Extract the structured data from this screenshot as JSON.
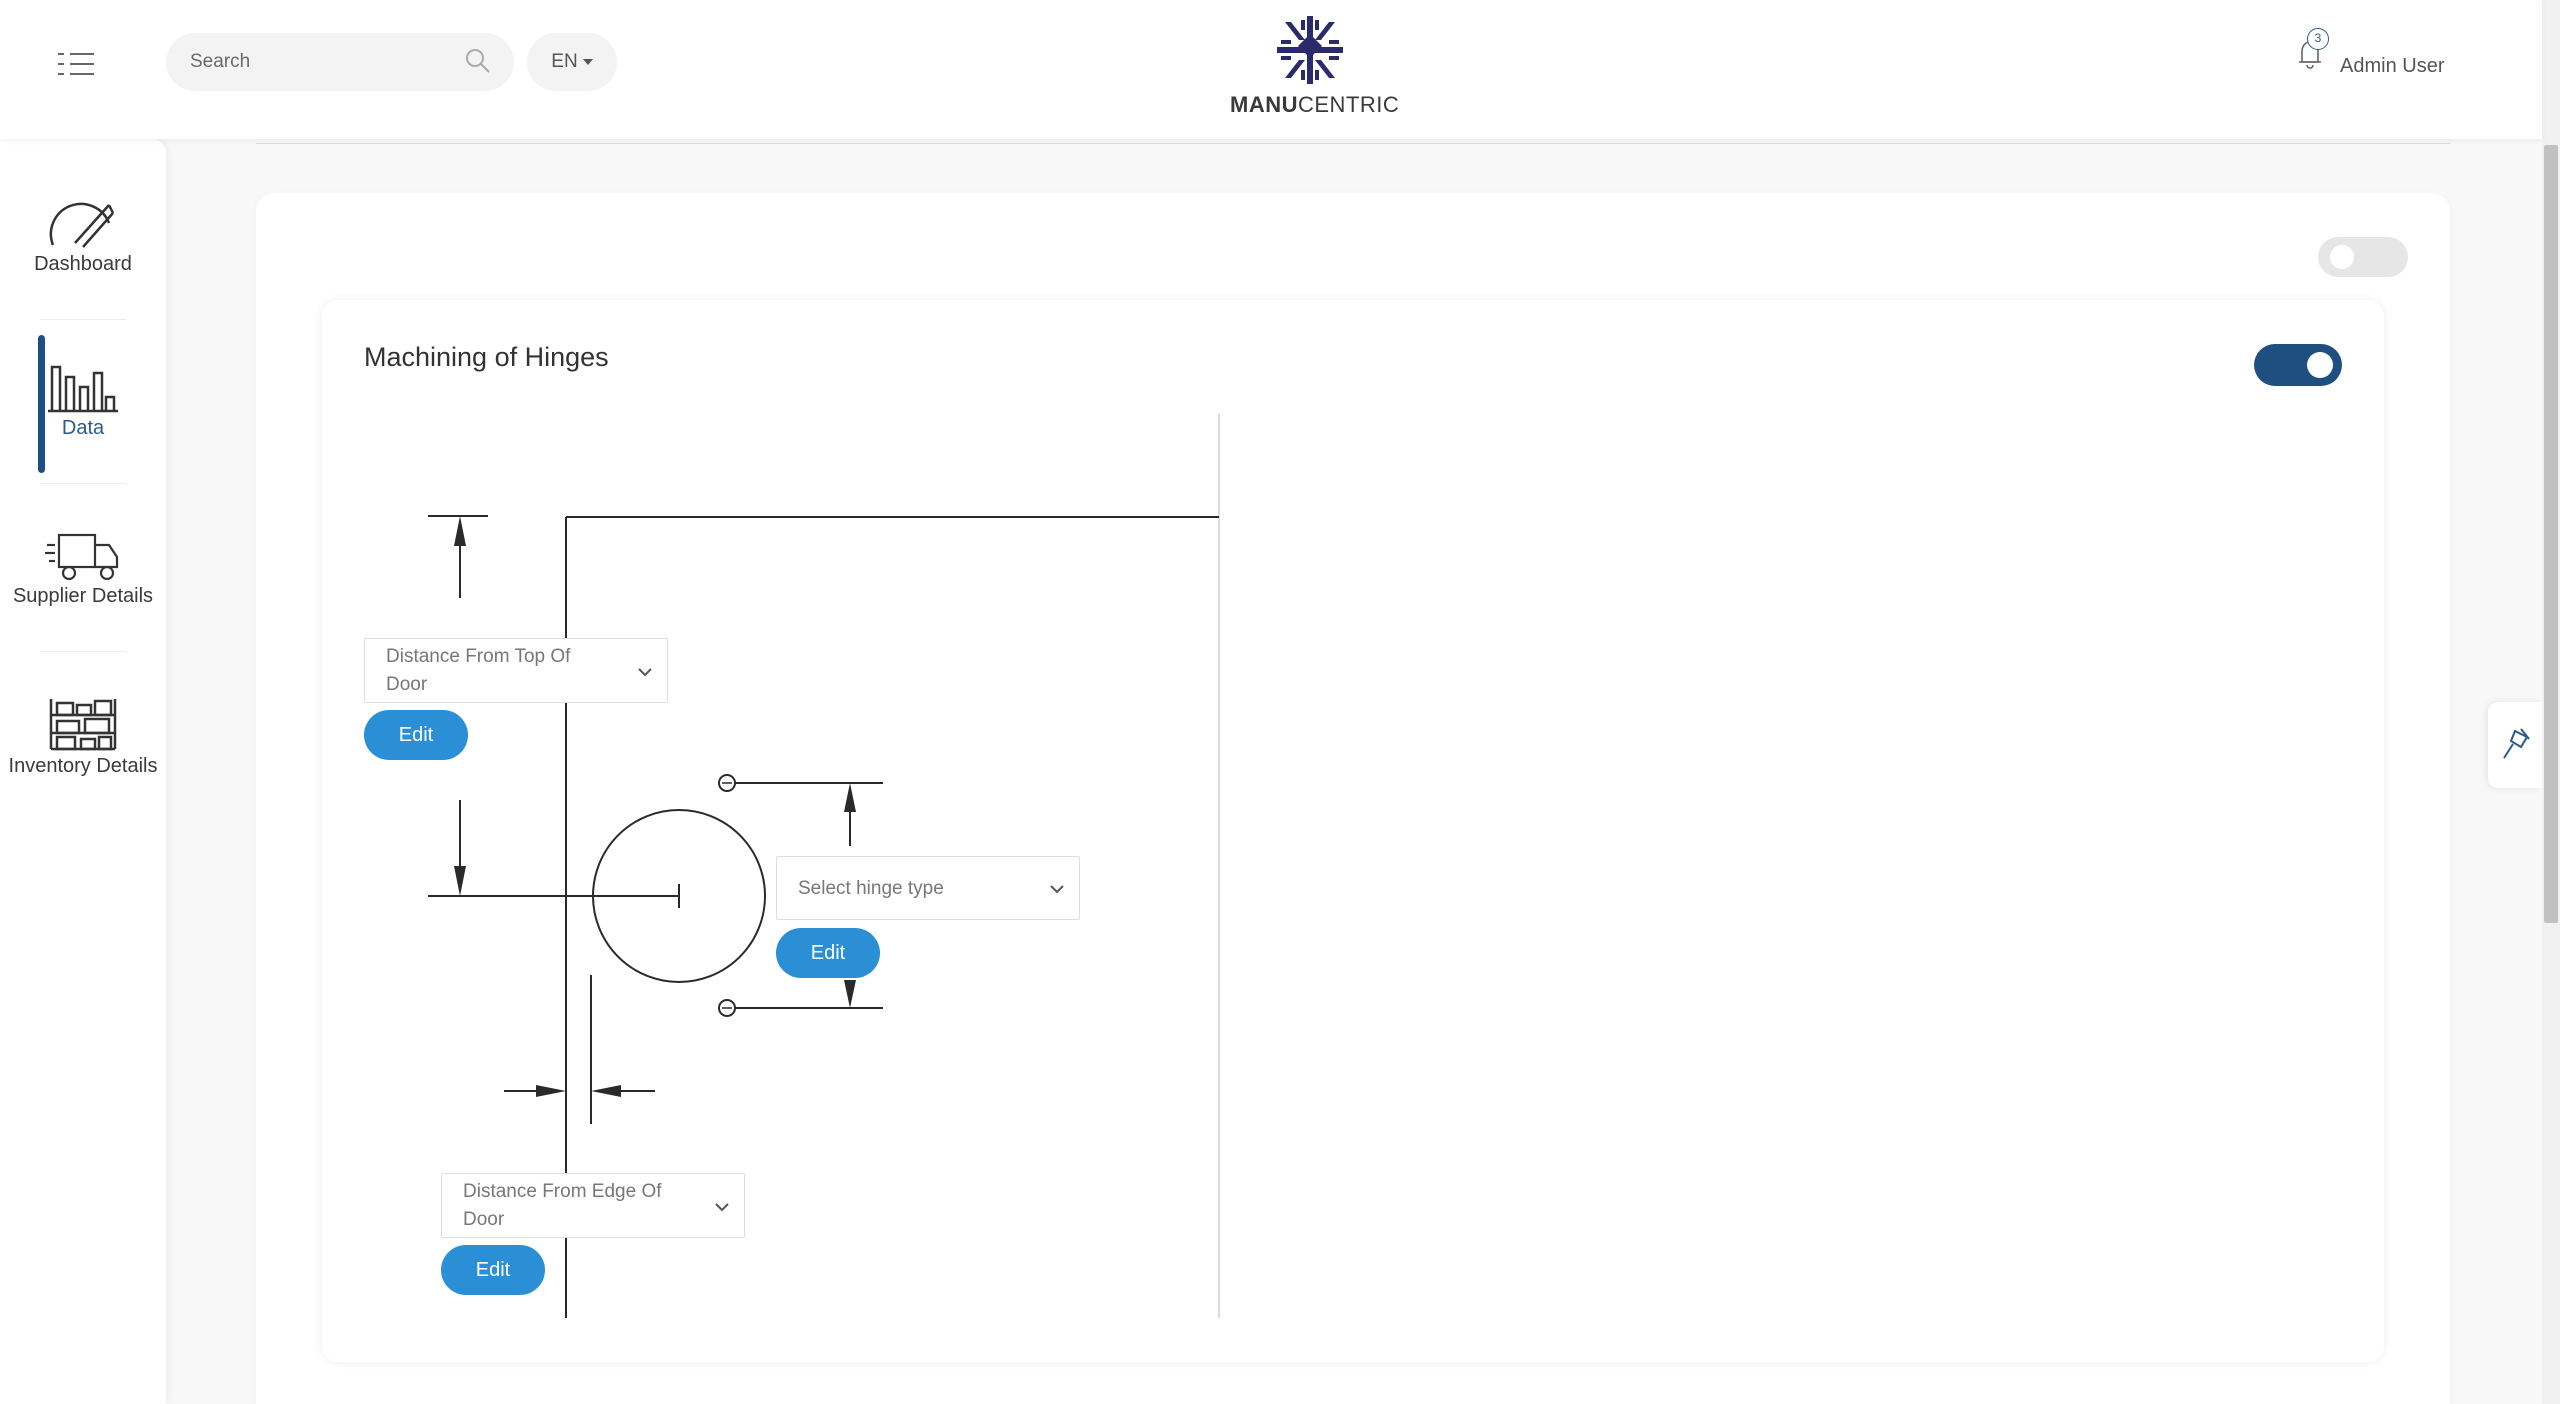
{
  "header": {
    "search_placeholder": "Search",
    "language": "EN",
    "logo_part1": "MANU",
    "logo_part2": "CENTRIC",
    "notification_count": "3",
    "user_name": "Admin User"
  },
  "sidebar": {
    "items": [
      {
        "label": "Dashboard",
        "icon": "dashboard-gauge-icon",
        "active": false
      },
      {
        "label": "Data",
        "icon": "bar-chart-icon",
        "active": true
      },
      {
        "label": "Supplier Details",
        "icon": "truck-icon",
        "active": false
      },
      {
        "label": "Inventory Details",
        "icon": "warehouse-shelves-icon",
        "active": false
      }
    ]
  },
  "card": {
    "title": "Machining of Hinges",
    "outer_toggle_on": false,
    "inner_toggle_on": true
  },
  "form": {
    "top_distance": {
      "text_line1": "Distance From Top Of",
      "text_line2": "Door",
      "edit_label": "Edit"
    },
    "hinge_type": {
      "placeholder": "Select hinge type",
      "edit_label": "Edit"
    },
    "edge_distance": {
      "text_line1": "Distance From Edge Of",
      "text_line2": "Door",
      "edit_label": "Edit"
    }
  },
  "colors": {
    "accent": "#1f4e80",
    "button": "#2b8fd6",
    "logo": "#2b2a6b"
  }
}
